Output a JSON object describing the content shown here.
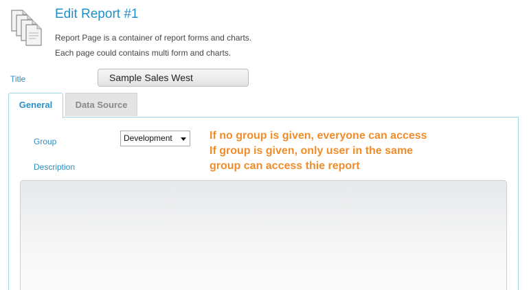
{
  "header": {
    "title": "Edit Report #1",
    "description_line1": "Report Page is a container of report forms and charts.",
    "description_line2": "Each page could contains multi form and charts.",
    "icon": "report-pages-icon"
  },
  "form": {
    "title_label": "Title",
    "title_value": "Sample Sales West"
  },
  "tabs": [
    {
      "label": "General",
      "active": true
    },
    {
      "label": "Data Source",
      "active": false
    }
  ],
  "general": {
    "group_label": "Group",
    "group_value": "Development",
    "description_label": "Description",
    "description_value": ""
  },
  "annotation": {
    "line1": "If no group is given, everyone can access",
    "line2": "If group is given, only user in the same",
    "line3": "group can access thie report",
    "color": "#f08c2a"
  },
  "colors": {
    "accent": "#2a8fc4",
    "tab_border": "#9fd6e6"
  }
}
